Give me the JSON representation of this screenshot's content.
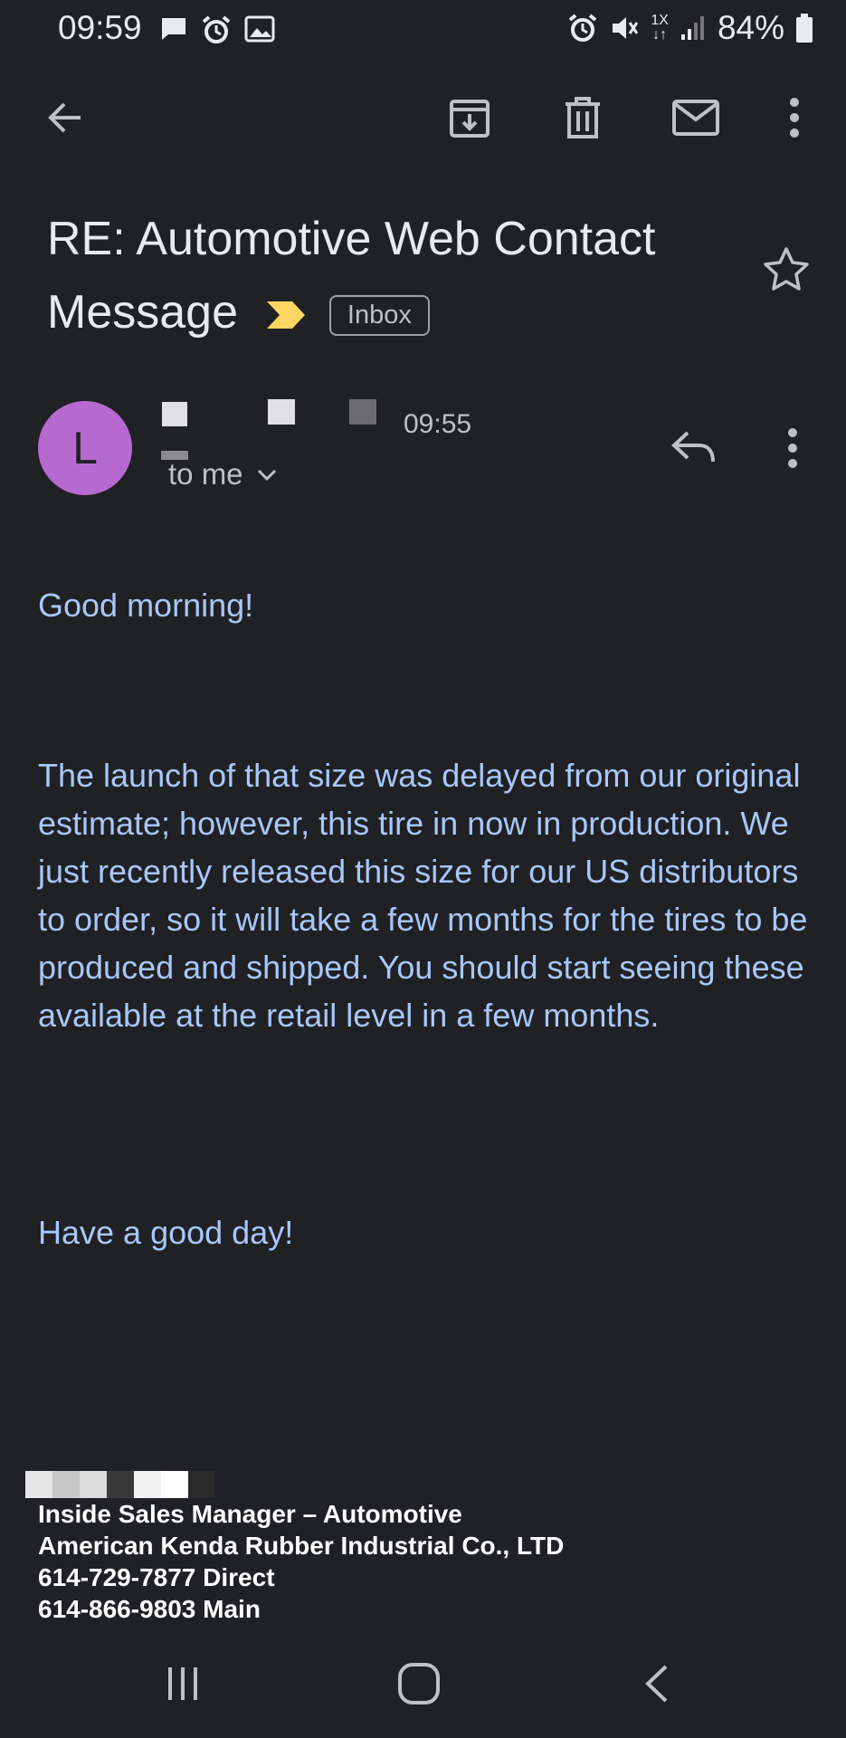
{
  "status_bar": {
    "time": "09:59",
    "left_icons": [
      "message-icon",
      "alarm-icon",
      "image-icon"
    ],
    "right_icons": [
      "alarm-icon",
      "mute-icon",
      "data-icon",
      "signal-icon",
      "battery-icon"
    ],
    "data_label": "1X",
    "battery_percent": "84%"
  },
  "toolbar": {
    "back": "back-arrow-icon",
    "actions": [
      "archive-icon",
      "delete-icon",
      "mark-unread-icon",
      "more-vert-icon"
    ]
  },
  "email": {
    "subject_line1": "RE: Automotive Web Contact",
    "subject_line2": "Message",
    "label": "Inbox",
    "avatar_letter": "L",
    "time": "09:55",
    "recipient": "to me",
    "greeting": "Good morning!",
    "body": "The launch of that size was delayed from our original estimate; however, this tire in now in production. We just recently released this size for our US distributors to order, so it will take a few months for the tires to be produced and shipped. You should start seeing these available at the retail level in a few months.",
    "closing": "Have a good day!"
  },
  "signature": {
    "title": "Inside Sales Manager – Automotive",
    "company": "American Kenda Rubber Industrial Co., LTD",
    "phone_direct": "614-729-7877 Direct",
    "phone_main": "614-866-9803 Main"
  },
  "nav_bar": [
    "recents-icon",
    "home-icon",
    "back-icon"
  ],
  "colors": {
    "background": "#202124",
    "body_text": "#a8c7fa",
    "avatar": "#b66ad0",
    "importance": "#fdd663"
  }
}
